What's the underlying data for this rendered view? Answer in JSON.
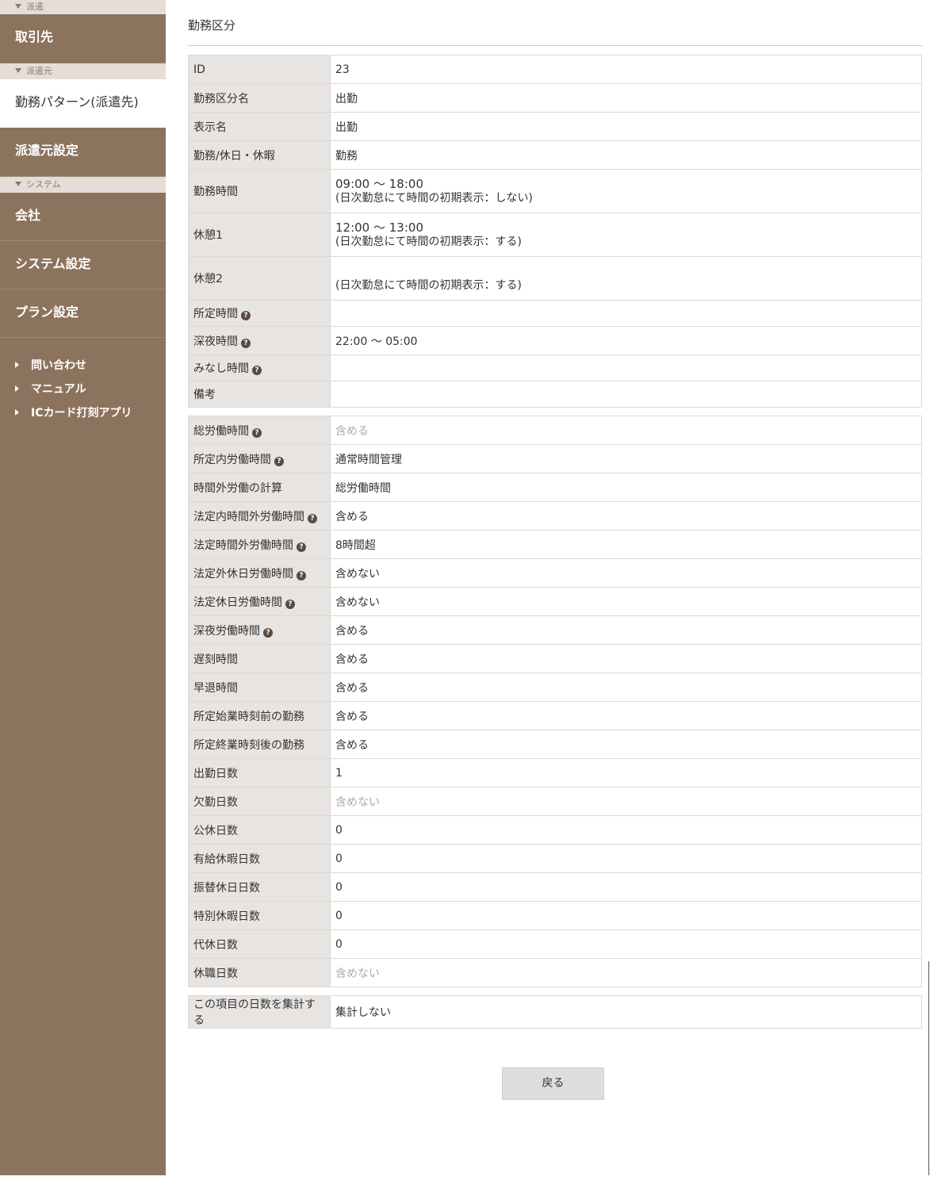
{
  "sidebar": {
    "sections": [
      {
        "header": "派遣",
        "items": [
          "取引先"
        ]
      },
      {
        "header": "派遣元",
        "items": [
          "勤務パターン(派遣先)",
          "派遣元設定"
        ]
      },
      {
        "header": "システム",
        "items": [
          "会社",
          "システム設定",
          "プラン設定"
        ]
      }
    ],
    "links": [
      "問い合わせ",
      "マニュアル",
      "ICカード打刻アプリ"
    ]
  },
  "page": {
    "title": "勤務区分",
    "back_label": "戻る"
  },
  "table1": [
    {
      "label": "ID",
      "value": "23",
      "help": false
    },
    {
      "label": "勤務区分名",
      "value": "出勤",
      "help": false
    },
    {
      "label": "表示名",
      "value": "出勤",
      "help": false
    },
    {
      "label": "勤務/休日・休暇",
      "value": "勤務",
      "help": false
    },
    {
      "label": "勤務時間",
      "line1": "09:00 ～ 18:00",
      "line2": "(日次勤怠にて時間の初期表示：しない)",
      "help": false
    },
    {
      "label": "休憩1",
      "line1": "12:00 ～ 13:00",
      "line2": "(日次勤怠にて時間の初期表示：する)",
      "help": false
    },
    {
      "label": "休憩2",
      "line1": "",
      "line2": "(日次勤怠にて時間の初期表示：する)",
      "help": false
    },
    {
      "label": "所定時間",
      "value": "",
      "help": true
    },
    {
      "label": "深夜時間",
      "value": "22:00 ～ 05:00",
      "help": true
    },
    {
      "label": "みなし時間",
      "value": "",
      "help": true
    },
    {
      "label": "備考",
      "value": "",
      "help": false
    }
  ],
  "table2": [
    {
      "label": "総労働時間",
      "value": "含める",
      "help": true,
      "muted": true
    },
    {
      "label": "所定内労働時間",
      "value": "通常時間管理",
      "help": true,
      "muted": false
    },
    {
      "label": "時間外労働の計算",
      "value": "総労働時間",
      "help": false,
      "muted": false
    },
    {
      "label": "法定内時間外労働時間",
      "value": "含める",
      "help": true,
      "muted": false
    },
    {
      "label": "法定時間外労働時間",
      "value": "8時間超",
      "help": true,
      "muted": false
    },
    {
      "label": "法定外休日労働時間",
      "value": "含めない",
      "help": true,
      "muted": false
    },
    {
      "label": "法定休日労働時間",
      "value": "含めない",
      "help": true,
      "muted": false
    },
    {
      "label": "深夜労働時間",
      "value": "含める",
      "help": true,
      "muted": false
    },
    {
      "label": "遅刻時間",
      "value": "含める",
      "help": false,
      "muted": false
    },
    {
      "label": "早退時間",
      "value": "含める",
      "help": false,
      "muted": false
    },
    {
      "label": "所定始業時刻前の勤務",
      "value": "含める",
      "help": false,
      "muted": false
    },
    {
      "label": "所定終業時刻後の勤務",
      "value": "含める",
      "help": false,
      "muted": false
    },
    {
      "label": "出勤日数",
      "value": "1",
      "help": false,
      "muted": false
    },
    {
      "label": "欠勤日数",
      "value": "含めない",
      "help": false,
      "muted": true
    },
    {
      "label": "公休日数",
      "value": "0",
      "help": false,
      "muted": false
    },
    {
      "label": "有給休暇日数",
      "value": "0",
      "help": false,
      "muted": false
    },
    {
      "label": "振替休日日数",
      "value": "0",
      "help": false,
      "muted": false
    },
    {
      "label": "特別休暇日数",
      "value": "0",
      "help": false,
      "muted": false
    },
    {
      "label": "代休日数",
      "value": "0",
      "help": false,
      "muted": false
    },
    {
      "label": "休職日数",
      "value": "含めない",
      "help": false,
      "muted": true
    }
  ],
  "table3": [
    {
      "label": "この項目の日数を集計する",
      "value": "集計しない",
      "help": false,
      "muted": false
    }
  ],
  "icons": {
    "help": "question-circle-icon",
    "section": "caret-down-icon",
    "link": "caret-right-icon"
  },
  "colors": {
    "sidebar": "#8c735e",
    "section_header": "#e6ddd6",
    "label_bg": "#e8e4e1"
  }
}
